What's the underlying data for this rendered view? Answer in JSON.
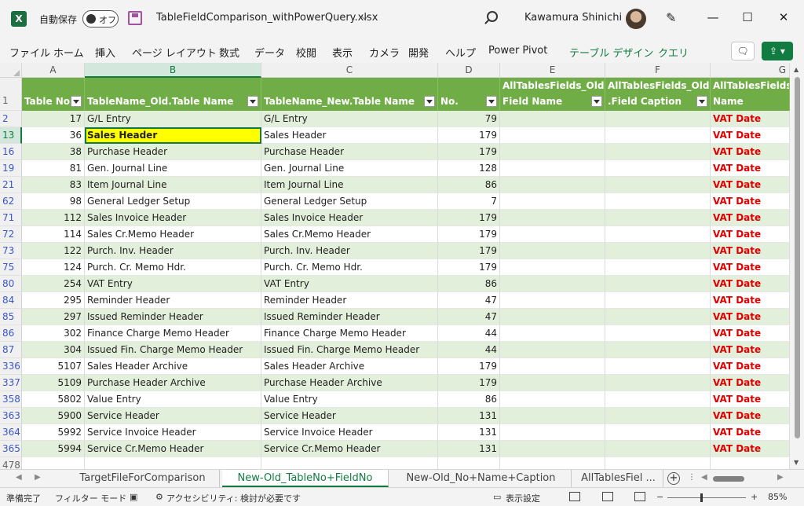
{
  "titlebar": {
    "app_icon": "X",
    "autosave_label": "自動保存",
    "autosave_state": "オフ",
    "filename": "TableFieldComparison_withPowerQuery.xlsx",
    "user": "Kawamura Shinichi"
  },
  "menu": [
    "ファイル",
    "ホーム",
    "挿入",
    "ページ レイアウト",
    "数式",
    "データ",
    "校閲",
    "表示",
    "カメラ",
    "開発",
    "ヘルプ",
    "Power Pivot",
    "テーブル デザイン",
    "クエリ"
  ],
  "columns": [
    "A",
    "B",
    "C",
    "D",
    "E",
    "F",
    "G"
  ],
  "header": {
    "row_num": "1",
    "a": "Table No.",
    "b": "TableName_Old.Table Name",
    "c": "TableName_New.Table Name",
    "d": "No.",
    "e_top": "AllTablesFields_Old.",
    "e_bot": "Field Name",
    "f_top": "AllTablesFields_Old",
    "f_bot": ".Field Caption",
    "g_top": "AllTablesFields",
    "g_bot": "Name"
  },
  "rows": [
    {
      "n": "2",
      "a": "17",
      "b": "G/L Entry",
      "c": "G/L Entry",
      "d": "79",
      "g": "VAT Date"
    },
    {
      "n": "13",
      "a": "36",
      "b": "Sales Header",
      "c": "Sales Header",
      "d": "179",
      "g": "VAT Date"
    },
    {
      "n": "16",
      "a": "38",
      "b": "Purchase Header",
      "c": "Purchase Header",
      "d": "179",
      "g": "VAT Date"
    },
    {
      "n": "19",
      "a": "81",
      "b": "Gen. Journal Line",
      "c": "Gen. Journal Line",
      "d": "128",
      "g": "VAT Date"
    },
    {
      "n": "21",
      "a": "83",
      "b": "Item Journal Line",
      "c": "Item Journal Line",
      "d": "86",
      "g": "VAT Date"
    },
    {
      "n": "62",
      "a": "98",
      "b": "General Ledger Setup",
      "c": "General Ledger Setup",
      "d": "7",
      "g": "VAT Date"
    },
    {
      "n": "71",
      "a": "112",
      "b": "Sales Invoice Header",
      "c": "Sales Invoice Header",
      "d": "179",
      "g": "VAT Date"
    },
    {
      "n": "72",
      "a": "114",
      "b": "Sales Cr.Memo Header",
      "c": "Sales Cr.Memo Header",
      "d": "179",
      "g": "VAT Date"
    },
    {
      "n": "73",
      "a": "122",
      "b": "Purch. Inv. Header",
      "c": "Purch. Inv. Header",
      "d": "179",
      "g": "VAT Date"
    },
    {
      "n": "75",
      "a": "124",
      "b": "Purch. Cr. Memo Hdr.",
      "c": "Purch. Cr. Memo Hdr.",
      "d": "179",
      "g": "VAT Date"
    },
    {
      "n": "80",
      "a": "254",
      "b": "VAT Entry",
      "c": "VAT Entry",
      "d": "86",
      "g": "VAT Date"
    },
    {
      "n": "84",
      "a": "295",
      "b": "Reminder Header",
      "c": "Reminder Header",
      "d": "47",
      "g": "VAT Date"
    },
    {
      "n": "85",
      "a": "297",
      "b": "Issued Reminder Header",
      "c": "Issued Reminder Header",
      "d": "47",
      "g": "VAT Date"
    },
    {
      "n": "86",
      "a": "302",
      "b": "Finance Charge Memo Header",
      "c": "Finance Charge Memo Header",
      "d": "44",
      "g": "VAT Date"
    },
    {
      "n": "87",
      "a": "304",
      "b": "Issued Fin. Charge Memo Header",
      "c": "Issued Fin. Charge Memo Header",
      "d": "44",
      "g": "VAT Date"
    },
    {
      "n": "336",
      "a": "5107",
      "b": "Sales Header Archive",
      "c": "Sales Header Archive",
      "d": "179",
      "g": "VAT Date"
    },
    {
      "n": "337",
      "a": "5109",
      "b": "Purchase Header Archive",
      "c": "Purchase Header Archive",
      "d": "179",
      "g": "VAT Date"
    },
    {
      "n": "358",
      "a": "5802",
      "b": "Value Entry",
      "c": "Value Entry",
      "d": "86",
      "g": "VAT Date"
    },
    {
      "n": "363",
      "a": "5900",
      "b": "Service Header",
      "c": "Service Header",
      "d": "131",
      "g": "VAT Date"
    },
    {
      "n": "364",
      "a": "5992",
      "b": "Service Invoice Header",
      "c": "Service Invoice Header",
      "d": "131",
      "g": "VAT Date"
    },
    {
      "n": "365",
      "a": "5994",
      "b": "Service Cr.Memo Header",
      "c": "Service Cr.Memo Header",
      "d": "131",
      "g": "VAT Date"
    }
  ],
  "blank_row": "478",
  "tabs": [
    "TargetFileForComparison",
    "New-Old_TableNo+FieldNo",
    "New-Old_No+Name+Caption",
    "AllTablesFiel ..."
  ],
  "active_tab": "New-Old_TableNo+FieldNo",
  "status": {
    "ready": "準備完了",
    "filter_mode": "フィルター モード",
    "accessibility": "アクセシビリティ: 検討が必要です",
    "display_settings": "表示設定",
    "zoom": "85%"
  },
  "colors": {
    "header_green": "#70ad47",
    "band_green": "#e2efda",
    "accent": "#107c41",
    "vat_red": "#e00000",
    "highlight": "#ffff00"
  }
}
